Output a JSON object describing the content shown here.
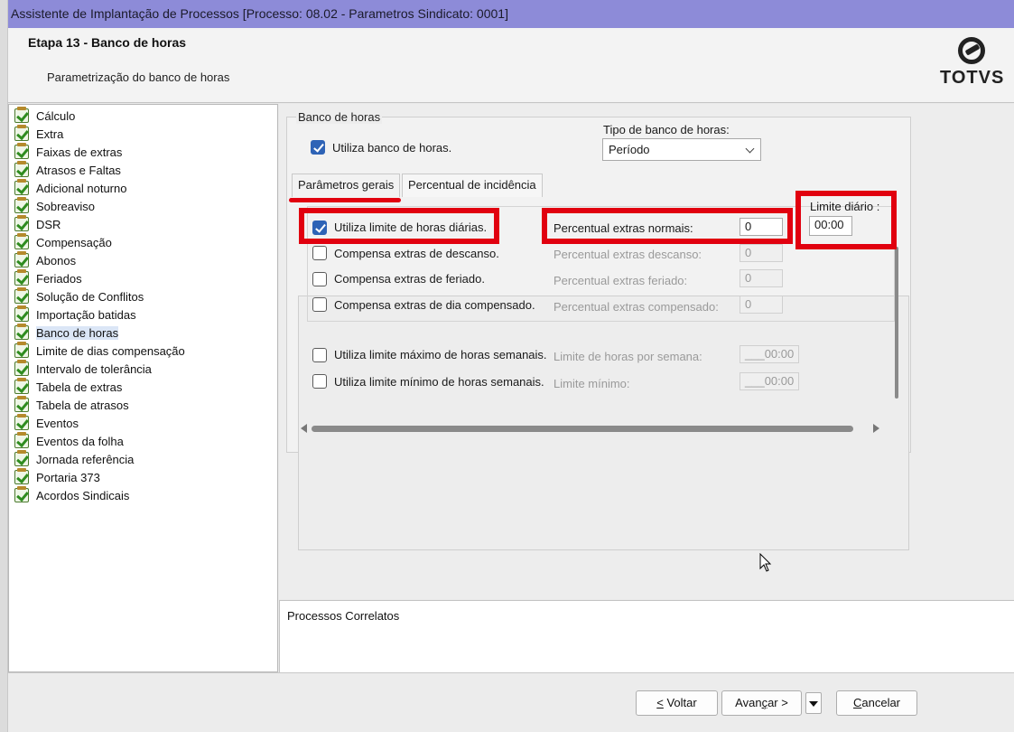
{
  "window": {
    "title": "Assistente de Implantação de Processos [Processo: 08.02 - Parametros Sindicato: 0001]"
  },
  "header": {
    "step_title": "Etapa 13 - Banco de horas",
    "step_subtitle": "Parametrização do banco de horas",
    "logo_text": "TOTVS"
  },
  "sidebar": {
    "items": [
      {
        "label": "Cálculo"
      },
      {
        "label": "Extra"
      },
      {
        "label": "Faixas de extras"
      },
      {
        "label": "Atrasos e Faltas"
      },
      {
        "label": "Adicional noturno"
      },
      {
        "label": "Sobreaviso"
      },
      {
        "label": "DSR"
      },
      {
        "label": "Compensação"
      },
      {
        "label": "Abonos"
      },
      {
        "label": "Feriados"
      },
      {
        "label": "Solução de Conflitos"
      },
      {
        "label": "Importação batidas"
      },
      {
        "label": "Banco de horas"
      },
      {
        "label": "Limite de dias compensação"
      },
      {
        "label": "Intervalo de tolerância"
      },
      {
        "label": "Tabela de extras"
      },
      {
        "label": "Tabela de atrasos"
      },
      {
        "label": "Eventos"
      },
      {
        "label": "Eventos da folha"
      },
      {
        "label": "Jornada referência"
      },
      {
        "label": "Portaria 373"
      },
      {
        "label": "Acordos Sindicais"
      }
    ],
    "selected": "Banco de horas"
  },
  "form": {
    "group_label": "Banco de horas",
    "use_bank": {
      "label": "Utiliza banco de horas.",
      "checked": true
    },
    "bank_type": {
      "label": "Tipo de banco de horas:",
      "value": "Período"
    },
    "tabs": [
      {
        "label": "Parâmetros gerais",
        "active": true
      },
      {
        "label": "Percentual de incidência",
        "active": false
      }
    ],
    "daily_limit_check": {
      "label": "Utiliza limite de horas diárias.",
      "checked": true
    },
    "comp_rest": {
      "label": "Compensa extras de descanso.",
      "checked": false
    },
    "comp_holiday": {
      "label": "Compensa extras de feriado.",
      "checked": false
    },
    "comp_day": {
      "label": "Compensa extras de dia compensado.",
      "checked": false
    },
    "pct_normal": {
      "label": "Percentual extras normais:",
      "value": "0"
    },
    "pct_rest": {
      "label": "Percentual extras descanso:",
      "value": "0"
    },
    "pct_holiday": {
      "label": "Percentual extras feriado:",
      "value": "0"
    },
    "pct_comp": {
      "label": "Percentual extras compensado:",
      "value": "0"
    },
    "daily_limit": {
      "label": "Limite diário :",
      "value": "00:00"
    },
    "weekly_max": {
      "label": "Utiliza limite máximo de horas semanais.",
      "checked": false,
      "field_label": "Limite de horas por semana:",
      "value": "___00:00"
    },
    "weekly_min": {
      "label": "Utiliza limite mínimo de horas semanais.",
      "checked": false,
      "field_label": "Limite mínimo:",
      "value": "___00:00"
    }
  },
  "related": {
    "label": "Processos Correlatos"
  },
  "footer": {
    "back_u": "<",
    "back_rest": " Voltar",
    "next_pre": "Avan",
    "next_u": "ç",
    "next_post": "ar >",
    "cancel_u": "C",
    "cancel_rest": "ancelar"
  },
  "colors": {
    "titlebar": "#8d8bd8",
    "highlight": "#e1000f",
    "checkbox_checked": "#2e63b6"
  }
}
